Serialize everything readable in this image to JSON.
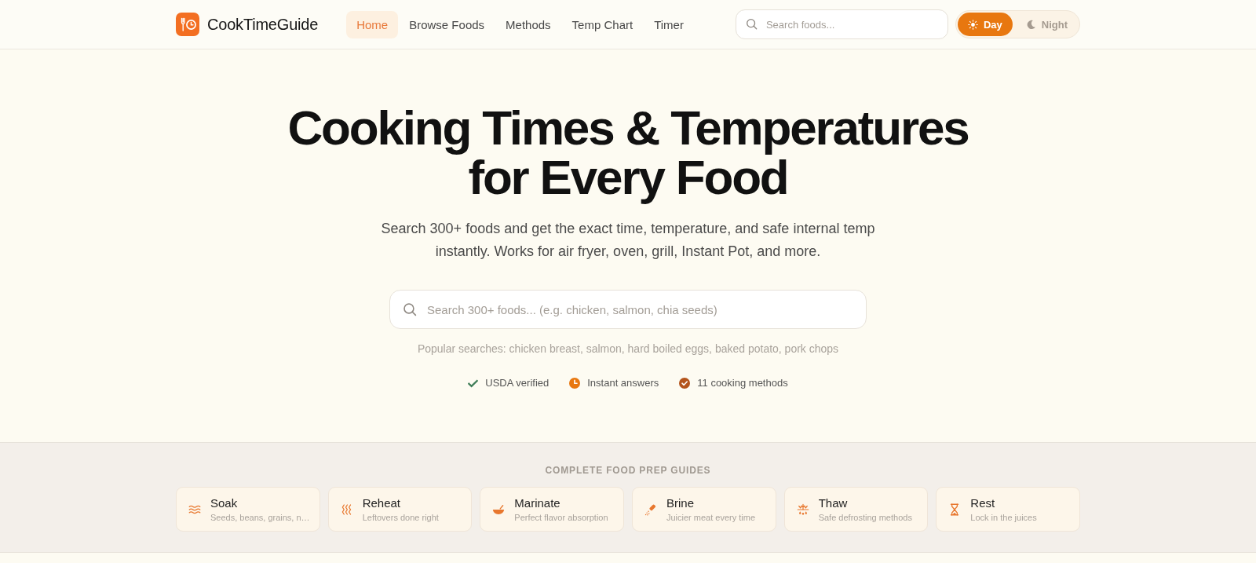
{
  "header": {
    "brand": "CookTimeGuide",
    "nav": [
      {
        "label": "Home",
        "selected": true
      },
      {
        "label": "Browse Foods",
        "selected": false
      },
      {
        "label": "Methods",
        "selected": false
      },
      {
        "label": "Temp Chart",
        "selected": false
      },
      {
        "label": "Timer",
        "selected": false
      }
    ],
    "search": {
      "placeholder": "Search foods..."
    },
    "theme_toggle": [
      {
        "kind": "day",
        "label": "Day",
        "selected": true
      },
      {
        "kind": "night",
        "label": "Night",
        "selected": false
      }
    ]
  },
  "hero": {
    "title": "Cooking Times & Temperatures for Every Food",
    "subtitle": "Search 300+ foods and get the exact time, temperature, and safe internal temp instantly. Works for air fryer, oven, grill, Instant Pot, and more.",
    "search": {
      "placeholder": "Search 300+ foods... (e.g. chicken, salmon, chia seeds)"
    },
    "popular_searches": "Popular searches: chicken breast, salmon, hard boiled eggs, baked potato, pork chops",
    "badges": [
      {
        "kind": "check",
        "label": "USDA verified",
        "color": "#3f7d58"
      },
      {
        "kind": "clock",
        "label": "Instant answers",
        "color": "#e8770f"
      },
      {
        "kind": "check-circle",
        "label": "11 cooking methods",
        "color": "#b4541b"
      }
    ]
  },
  "prep_guides": {
    "heading": "COMPLETE FOOD PREP GUIDES",
    "cards": [
      {
        "kind": "soak",
        "title": "Soak",
        "subtitle": "Seeds, beans, grains, n…"
      },
      {
        "kind": "reheat",
        "title": "Reheat",
        "subtitle": "Leftovers done right"
      },
      {
        "kind": "marinate",
        "title": "Marinate",
        "subtitle": "Perfect flavor absorption"
      },
      {
        "kind": "brine",
        "title": "Brine",
        "subtitle": "Juicier meat every time"
      },
      {
        "kind": "thaw",
        "title": "Thaw",
        "subtitle": "Safe defrosting methods"
      },
      {
        "kind": "rest",
        "title": "Rest",
        "subtitle": "Lock in the juices"
      }
    ]
  }
}
